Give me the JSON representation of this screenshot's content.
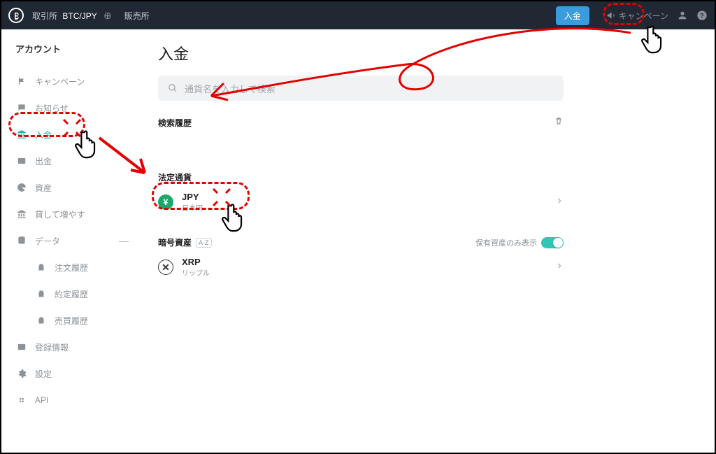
{
  "topbar": {
    "exchange_label": "取引所",
    "pair": "BTC/JPY",
    "sales_label": "販売所",
    "deposit_btn": "入金",
    "campaign": "キャンペーン"
  },
  "sidebar": {
    "title": "アカウント",
    "items": {
      "campaign": "キャンペーン",
      "notice": "お知らせ",
      "deposit": "入金",
      "withdraw": "出金",
      "assets": "資産",
      "lending": "貸して増やす",
      "data": "データ",
      "order_history": "注文履歴",
      "trade_history": "約定履歴",
      "txn_history": "売買履歴",
      "registration": "登録情報",
      "settings": "設定",
      "api": "API"
    }
  },
  "content": {
    "title": "入金",
    "search_placeholder": "通貨名を入力して検索",
    "search_history": "検索履歴",
    "fiat_label": "法定通貨",
    "crypto_label": "暗号資産",
    "sort_hint": "A-Z",
    "owned_only": "保有資産のみ表示",
    "jpy": {
      "code": "JPY",
      "name": "日本円"
    },
    "xrp": {
      "code": "XRP",
      "name": "リップル"
    }
  }
}
